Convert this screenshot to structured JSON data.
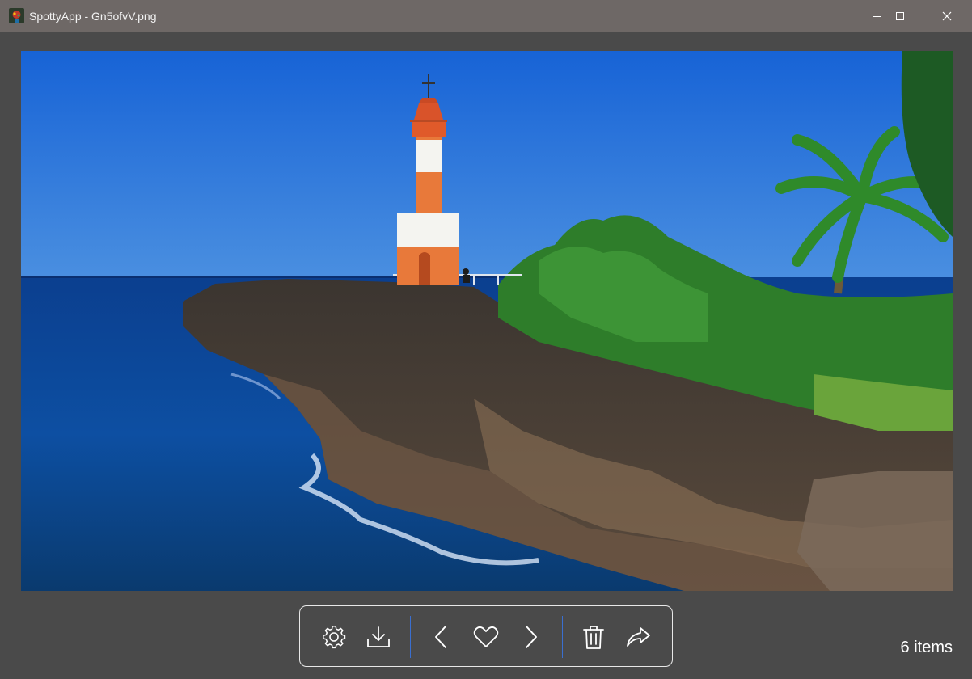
{
  "window": {
    "title": "SpottyApp - Gn5ofvV.png",
    "minimize_icon": "minimize-icon",
    "maximize_icon": "maximize-icon",
    "close_icon": "close-icon"
  },
  "viewer": {
    "image_name": "Gn5ofvV.png",
    "image_subject": "lighthouse on rocky coast"
  },
  "toolbar": {
    "items": [
      {
        "icon": "gear-icon"
      },
      {
        "icon": "download-icon"
      },
      {
        "icon": "chevron-left-icon"
      },
      {
        "icon": "heart-icon"
      },
      {
        "icon": "chevron-right-icon"
      },
      {
        "icon": "trash-icon"
      },
      {
        "icon": "share-icon"
      }
    ],
    "separator_color": "#3a6fd0"
  },
  "status": {
    "item_count": "6 items"
  },
  "colors": {
    "background": "#4a4a4a",
    "titlebar": "#6e6866",
    "toolbar_border": "#e8e8e8"
  }
}
